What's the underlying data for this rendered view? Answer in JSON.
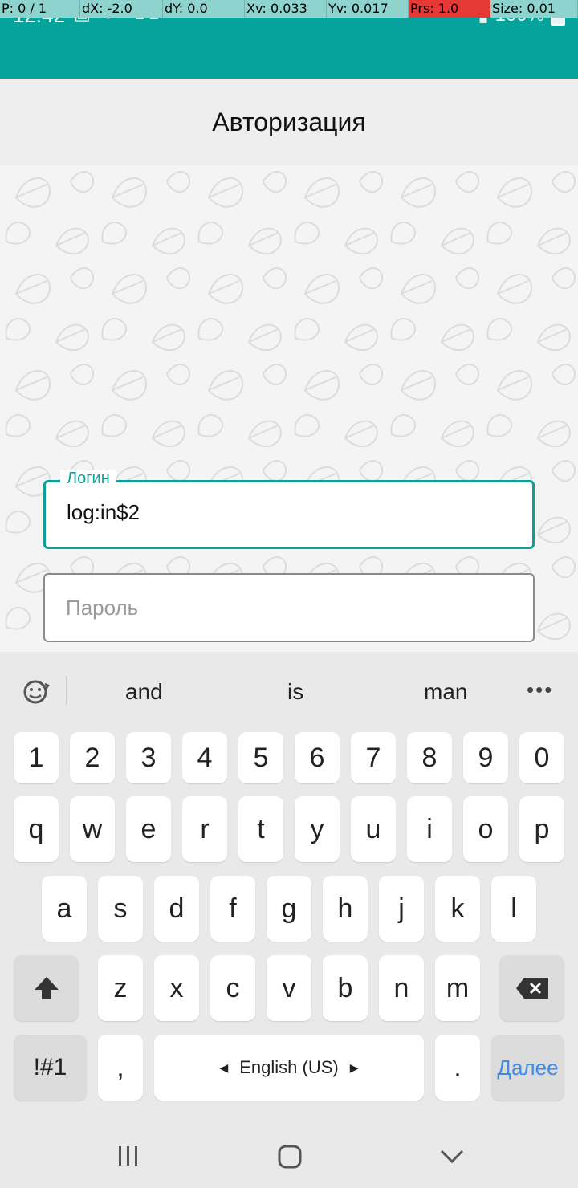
{
  "debug_overlay": {
    "items": [
      "P: 0 / 1",
      "dX: -2.0",
      "dY: 0.0",
      "Xv: 0.033",
      "Yv: 0.017",
      "Prs: 1.0",
      "Size: 0.01"
    ],
    "accent": "#8fd3cf",
    "highlight": "#e53935"
  },
  "status_bar": {
    "time": "12:42",
    "battery": "100%",
    "icons": [
      "image-icon",
      "telegram-icon",
      "number-icon",
      "dots-icon"
    ],
    "color": "#06a29c"
  },
  "header": {
    "title": "Авторизация"
  },
  "login": {
    "login_label": "Логин",
    "login_value": "log:in$2",
    "password_placeholder": "Пароль",
    "accent": "#0f9f9a"
  },
  "keyboard": {
    "suggestions": [
      "and",
      "is",
      "man"
    ],
    "number_row": [
      "1",
      "2",
      "3",
      "4",
      "5",
      "6",
      "7",
      "8",
      "9",
      "0"
    ],
    "row1": [
      "q",
      "w",
      "e",
      "r",
      "t",
      "y",
      "u",
      "i",
      "o",
      "p"
    ],
    "row2": [
      "a",
      "s",
      "d",
      "f",
      "g",
      "h",
      "j",
      "k",
      "l"
    ],
    "row3": [
      "z",
      "x",
      "c",
      "v",
      "b",
      "n",
      "m"
    ],
    "symbols_key": "!#1",
    "comma_key": ",",
    "space_label": "English (US)",
    "period_key": ".",
    "action_label": "Далее",
    "action_color": "#3f8ce6"
  },
  "nav_bar": {
    "icons": [
      "recents-icon",
      "home-icon",
      "back-icon"
    ]
  }
}
